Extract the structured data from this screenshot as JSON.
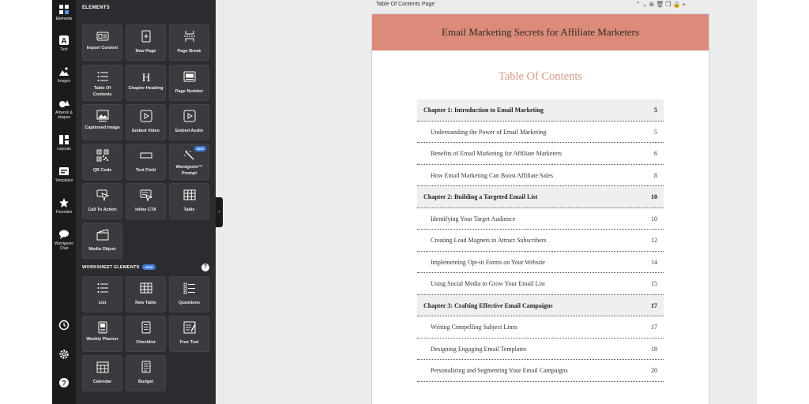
{
  "rail": [
    {
      "label": "Elements",
      "icon": "elements-icon",
      "active": true
    },
    {
      "label": "Text",
      "icon": "text-icon"
    },
    {
      "label": "Images",
      "icon": "images-icon"
    },
    {
      "label": "Artwork & shapes",
      "icon": "shapes-icon"
    },
    {
      "label": "Layouts",
      "icon": "layouts-icon"
    },
    {
      "label": "Templates",
      "icon": "templates-icon"
    },
    {
      "label": "Favorites",
      "icon": "star-icon"
    },
    {
      "label": "Wordgenie Chat",
      "icon": "chat-icon"
    }
  ],
  "rail_bottom": [
    {
      "icon": "history-icon"
    },
    {
      "icon": "gear-icon"
    },
    {
      "icon": "help-icon"
    }
  ],
  "panel": {
    "title": "ELEMENTS",
    "elements": [
      {
        "label": "Import Content",
        "icon": "import-icon"
      },
      {
        "label": "New Page",
        "icon": "new-page-icon"
      },
      {
        "label": "Page Break",
        "icon": "page-break-icon"
      },
      {
        "label": "Table Of Contents",
        "icon": "toc-icon"
      },
      {
        "label": "Chapter Heading",
        "icon": "heading-icon"
      },
      {
        "label": "Page Number",
        "icon": "page-number-icon"
      },
      {
        "label": "Captioned Image",
        "icon": "captioned-image-icon"
      },
      {
        "label": "Embed Video",
        "icon": "video-icon"
      },
      {
        "label": "Embed Audio",
        "icon": "audio-icon"
      },
      {
        "label": "QR Code",
        "icon": "qr-code-icon"
      },
      {
        "label": "Text Field",
        "icon": "text-field-icon"
      },
      {
        "label": "Wordgenie™ Prompt",
        "icon": "magic-wand-icon",
        "badge": "NEW"
      },
      {
        "label": "Call To Action",
        "icon": "cursor-icon"
      },
      {
        "label": "Inline CTA",
        "icon": "inline-cta-icon"
      },
      {
        "label": "Table",
        "icon": "table-icon"
      },
      {
        "label": "Media Object",
        "icon": "clapper-icon"
      }
    ],
    "worksheet_title": "WORKSHEET ELEMENTS",
    "worksheet_badge": "NEW",
    "worksheet": [
      {
        "label": "List",
        "icon": "list-icon"
      },
      {
        "label": "New Table",
        "icon": "table-icon"
      },
      {
        "label": "Questions",
        "icon": "questions-icon"
      },
      {
        "label": "Weekly Planner",
        "icon": "planner-icon"
      },
      {
        "label": "Checklist",
        "icon": "checklist-icon"
      },
      {
        "label": "Free Text",
        "icon": "free-text-icon"
      },
      {
        "label": "Calendar",
        "icon": "calendar-icon"
      },
      {
        "label": "Budget",
        "icon": "budget-icon"
      }
    ]
  },
  "page_label": "Table Of Contents Page",
  "document": {
    "title": "Email Marketing Secrets for Affiliate Marketers",
    "toc_heading": "Table Of Contents",
    "header_color": "#db8b78",
    "entries": [
      {
        "title": "Chapter 1: Introduction to Email Marketing",
        "page": "5",
        "chapter": true
      },
      {
        "title": "Understanding the Power of Email Marketing",
        "page": "5"
      },
      {
        "title": "Benefits of Email Marketing for Affiliate Marketers",
        "page": "6"
      },
      {
        "title": "How Email Marketing Can Boost Affiliate Sales",
        "page": "8"
      },
      {
        "title": "Chapter 2: Building a Targeted Email List",
        "page": "10",
        "chapter": true
      },
      {
        "title": "Identifying Your Target Audience",
        "page": "10"
      },
      {
        "title": "Creating Lead Magnets to Attract Subscribers",
        "page": "12"
      },
      {
        "title": "Implementing Opt-in Forms on Your Website",
        "page": "14"
      },
      {
        "title": "Using Social Media to Grow Your Email List",
        "page": "15"
      },
      {
        "title": "Chapter 3: Crafting Effective Email Campaigns",
        "page": "17",
        "chapter": true
      },
      {
        "title": "Writing Compelling Subject Lines",
        "page": "17"
      },
      {
        "title": "Designing Engaging Email Templates",
        "page": "18"
      },
      {
        "title": "Personalizing and Segmenting Your Email Campaigns",
        "page": "20"
      }
    ]
  }
}
